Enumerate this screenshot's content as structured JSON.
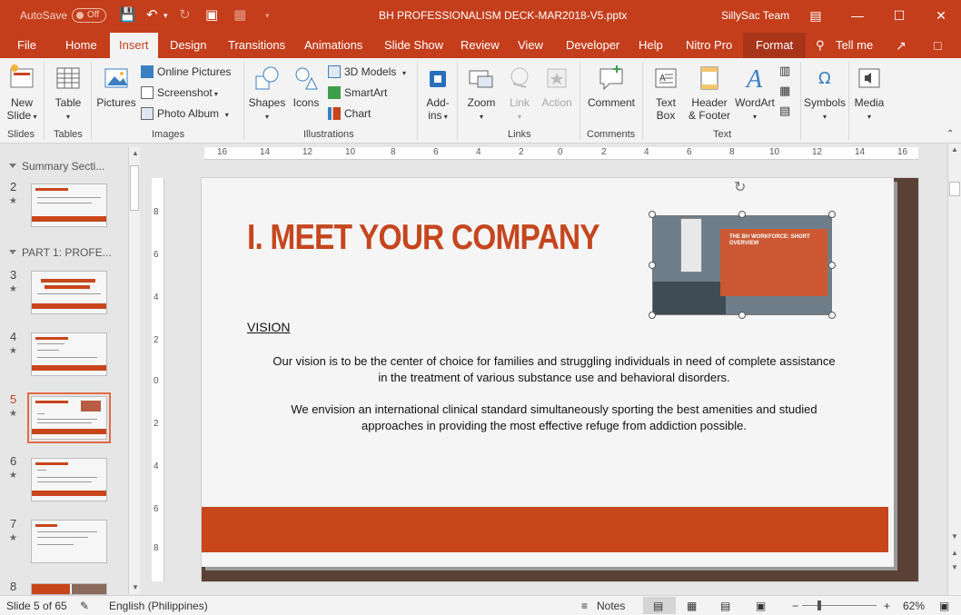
{
  "titlebar": {
    "autosave": "AutoSave",
    "autosave_state": "Off",
    "doc_title": "BH PROFESSIONALISM DECK-MAR2018-V5.pptx",
    "user": "SillySac Team"
  },
  "tabs": [
    "File",
    "Home",
    "Insert",
    "Design",
    "Transitions",
    "Animations",
    "Slide Show",
    "Review",
    "View",
    "Developer",
    "Help",
    "Nitro Pro",
    "Format"
  ],
  "tell_me": "Tell me",
  "ribbon": {
    "slides": {
      "new_slide": "New",
      "new_slide2": "Slide",
      "group": "Slides"
    },
    "tables": {
      "table": "Table",
      "group": "Tables"
    },
    "images": {
      "pictures": "Pictures",
      "online_pictures": "Online Pictures",
      "screenshot": "Screenshot",
      "photo_album": "Photo Album",
      "group": "Images"
    },
    "illustrations": {
      "shapes": "Shapes",
      "icons": "Icons",
      "models3d": "3D Models",
      "smartart": "SmartArt",
      "chart": "Chart",
      "group": "Illustrations"
    },
    "addins": {
      "label1": "Add-",
      "label2": "ins"
    },
    "links": {
      "zoom": "Zoom",
      "link": "Link",
      "action": "Action",
      "group": "Links"
    },
    "comments": {
      "comment": "Comment",
      "group": "Comments"
    },
    "text": {
      "textbox1": "Text",
      "textbox2": "Box",
      "header1": "Header",
      "header2": "& Footer",
      "wordart": "WordArt",
      "group": "Text"
    },
    "symbols": {
      "label": "Symbols"
    },
    "media": {
      "label": "Media"
    }
  },
  "thumbpanel": {
    "section1": "Summary Secti...",
    "section2": "PART 1: PROFE...",
    "slides": [
      "2",
      "3",
      "4",
      "5",
      "6",
      "7",
      "8"
    ],
    "star": "★"
  },
  "ruler": {
    "h_ticks": [
      "16",
      "14",
      "12",
      "10",
      "8",
      "6",
      "4",
      "2",
      "0",
      "2",
      "4",
      "6",
      "8",
      "10",
      "12",
      "14",
      "16"
    ],
    "v_ticks": [
      "8",
      "6",
      "4",
      "2",
      "0",
      "2",
      "4",
      "6",
      "8"
    ]
  },
  "slide": {
    "title": "I. MEET YOUR COMPANY",
    "vision_heading": "VISION",
    "para1": "Our vision is to be the center of choice for families and struggling individuals in need of complete assistance in the treatment of various substance use and behavioral disorders.",
    "para2": "We envision an international clinical standard simultaneously sporting the best amenities and studied approaches in providing the most effective refuge from addiction possible.",
    "image_caption": "THE BH WORKFORCE: SHORT OVERVIEW"
  },
  "statusbar": {
    "slide_count": "Slide 5 of 65",
    "language": "English (Philippines)",
    "notes": "Notes",
    "zoom": "62%",
    "minus": "−",
    "plus": "+"
  },
  "colors": {
    "accent": "#c43e1c",
    "slide_orange": "#c8461c"
  }
}
